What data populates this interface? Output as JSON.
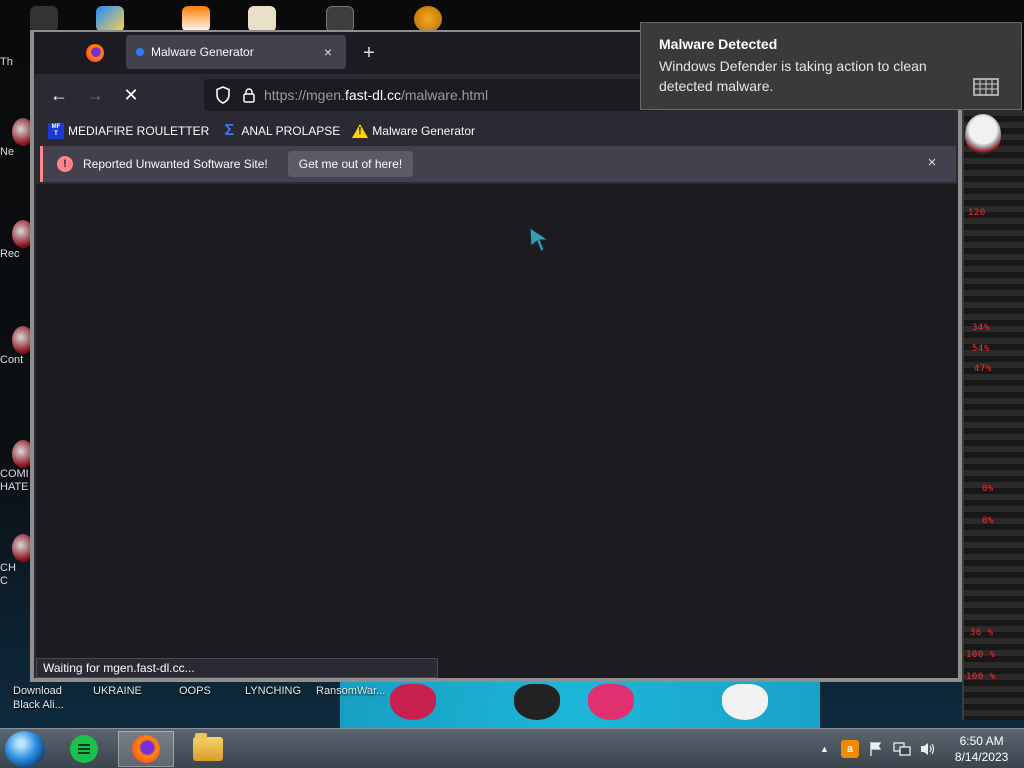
{
  "desktop": {
    "left_icons": [
      {
        "label": "Th"
      },
      {
        "label": "Ne"
      },
      {
        "label": "Rec"
      },
      {
        "label": "Cont"
      },
      {
        "label": "COMI\nHATE"
      },
      {
        "label": "CH\nC"
      }
    ],
    "bottom_icons": [
      {
        "label": "Download\nBlack Ali..."
      },
      {
        "label": "UKRAINE"
      },
      {
        "label": "OOPS"
      },
      {
        "label": "LYNCHING"
      },
      {
        "label": "RansomWar..."
      }
    ],
    "alien_readouts": [
      "120",
      "34%",
      "54%",
      "47%",
      "0%",
      "0%",
      "36 %",
      "100 %",
      "100 %"
    ]
  },
  "browser": {
    "tab": {
      "title": "Malware Generator",
      "close": "×"
    },
    "new_tab": "+",
    "nav": {
      "back": "←",
      "forward": "→",
      "stop": "✕"
    },
    "url": {
      "prefix": "https://mgen.",
      "domain": "fast-dl.cc",
      "path": "/malware.html"
    },
    "bookmarks": [
      {
        "label": "MEDIAFIRE ROULETTER",
        "icon": "mediafire-icon"
      },
      {
        "label": "ANAL PROLAPSE",
        "icon": "sigma-icon"
      },
      {
        "label": "Malware Generator",
        "icon": "warning-icon"
      }
    ],
    "warning": {
      "icon": "!",
      "message": "Reported Unwanted Software Site!",
      "button": "Get me out of here!",
      "close": "×"
    },
    "status": "Waiting for mgen.fast-dl.cc..."
  },
  "toast": {
    "title": "Malware Detected",
    "message": "Windows Defender is taking action to clean detected malware."
  },
  "taskbar": {
    "apps": [
      "notes",
      "firefox",
      "file-explorer"
    ],
    "tray": {
      "show_hidden": "▲"
    },
    "clock": {
      "time": "6:50 AM",
      "date": "8/14/2023"
    }
  },
  "colors": {
    "warning_accent": "#ff848b",
    "browser_bg": "#2b2a33",
    "alien_red": "#ff2a2a"
  }
}
